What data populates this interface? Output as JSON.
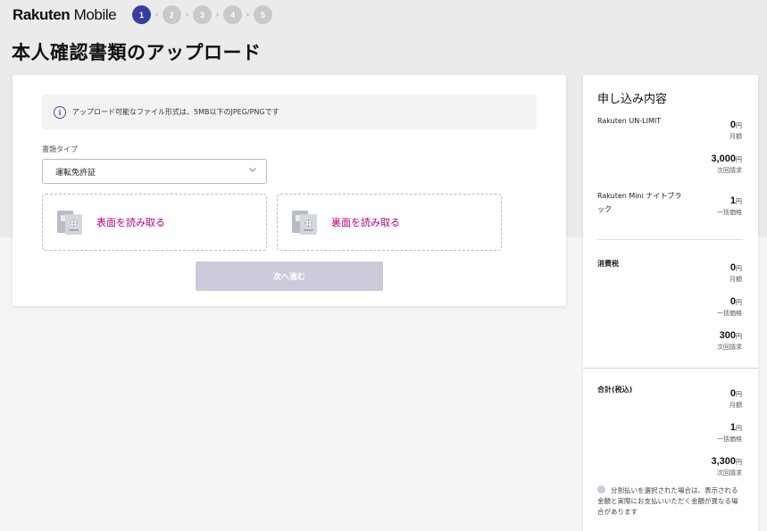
{
  "header": {
    "logo_text_bold": "Rakuten",
    "logo_text_light": " Mobile",
    "steps": [
      "1",
      "2",
      "3",
      "4",
      "5"
    ]
  },
  "page": {
    "title": "本人確認書類のアップロード"
  },
  "upload": {
    "info_text": "アップロード可能なファイル形式は、5MB以下のJPEG/PNGです",
    "doc_type_label": "書類タイプ",
    "doc_type_value": "運転免許証",
    "front_label": "表面を読み取る",
    "back_label": "裏面を読み取る",
    "next_button": "次へ進む"
  },
  "summary": {
    "title": "申し込み内容",
    "items": [
      {
        "label": "Rakuten UN-LIMIT",
        "amount": "0",
        "unit": "円",
        "note": "月額"
      },
      {
        "label": "",
        "amount": "3,000",
        "unit": "円",
        "note": "次回請求"
      },
      {
        "label": "Rakuten Mini ナイトブラック",
        "amount": "1",
        "unit": "円",
        "note": "一括価格"
      }
    ],
    "tax": {
      "label": "消費税",
      "rows": [
        {
          "amount": "0",
          "unit": "円",
          "note": "月額"
        },
        {
          "amount": "0",
          "unit": "円",
          "note": "一括価格"
        },
        {
          "amount": "300",
          "unit": "円",
          "note": "次回請求"
        }
      ]
    },
    "total": {
      "label": "合計(税込)",
      "rows": [
        {
          "amount": "0",
          "unit": "円",
          "note": "月額"
        },
        {
          "amount": "1",
          "unit": "円",
          "note": "一括価格"
        },
        {
          "amount": "3,300",
          "unit": "円",
          "note": "次回請求"
        }
      ]
    },
    "note": "分割払いを選択された場合は、表示される金額と実際にお支払いいただく金額が異なる場合があります"
  },
  "colors": {
    "accent": "#3b3ba0",
    "link": "#b5007a",
    "button_disabled": "#cbcbdc"
  }
}
